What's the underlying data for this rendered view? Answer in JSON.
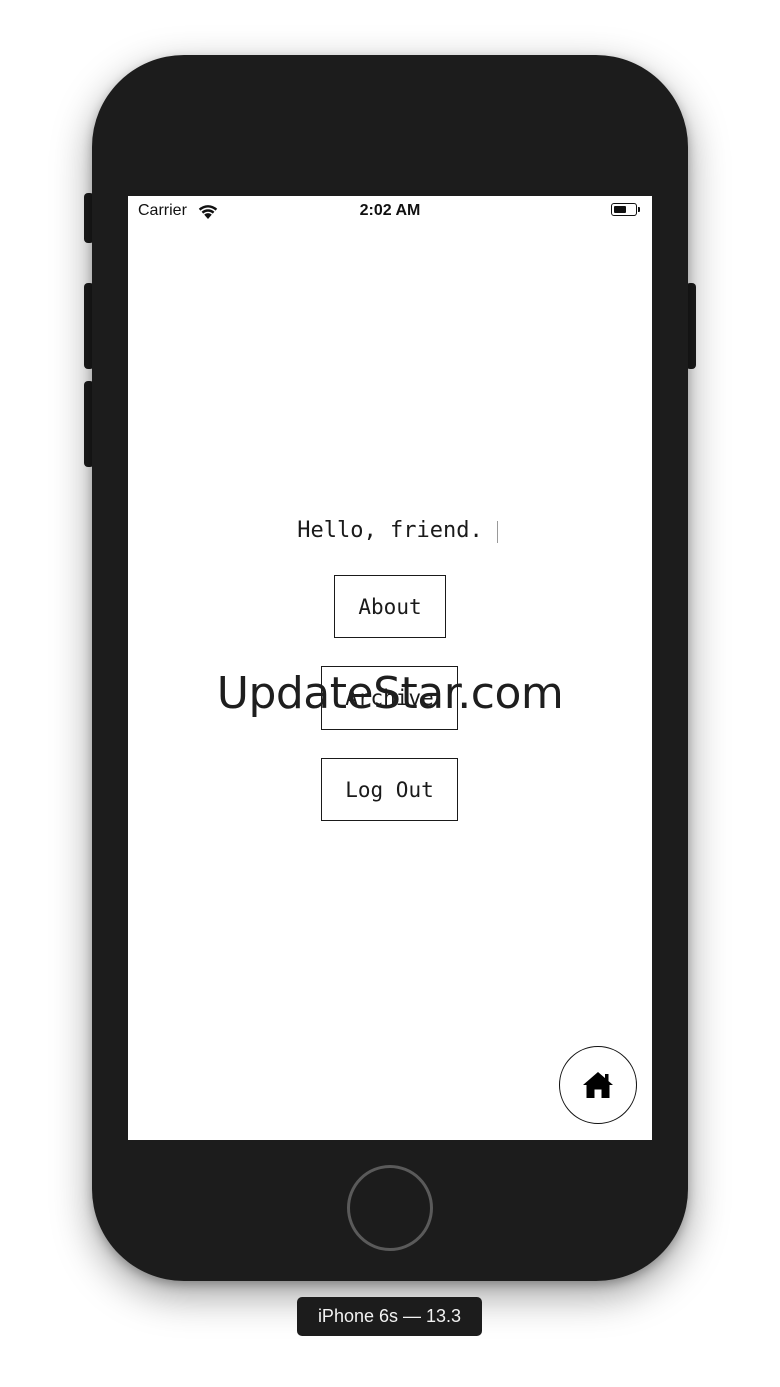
{
  "status_bar": {
    "carrier": "Carrier",
    "time": "2:02 AM",
    "wifi_icon": "wifi-icon",
    "battery_icon": "battery-icon",
    "battery_level": 0.6
  },
  "main": {
    "greeting": "Hello, friend.",
    "buttons": {
      "about": "About",
      "archive": "Archive",
      "logout": "Log Out"
    },
    "home_icon": "home-icon"
  },
  "watermark": "UpdateStar.com",
  "simulator": {
    "device_label": "iPhone 6s — 13.3"
  },
  "colors": {
    "device_body": "#1c1c1c",
    "screen_bg": "#ffffff",
    "ink": "#1a1a1a"
  }
}
